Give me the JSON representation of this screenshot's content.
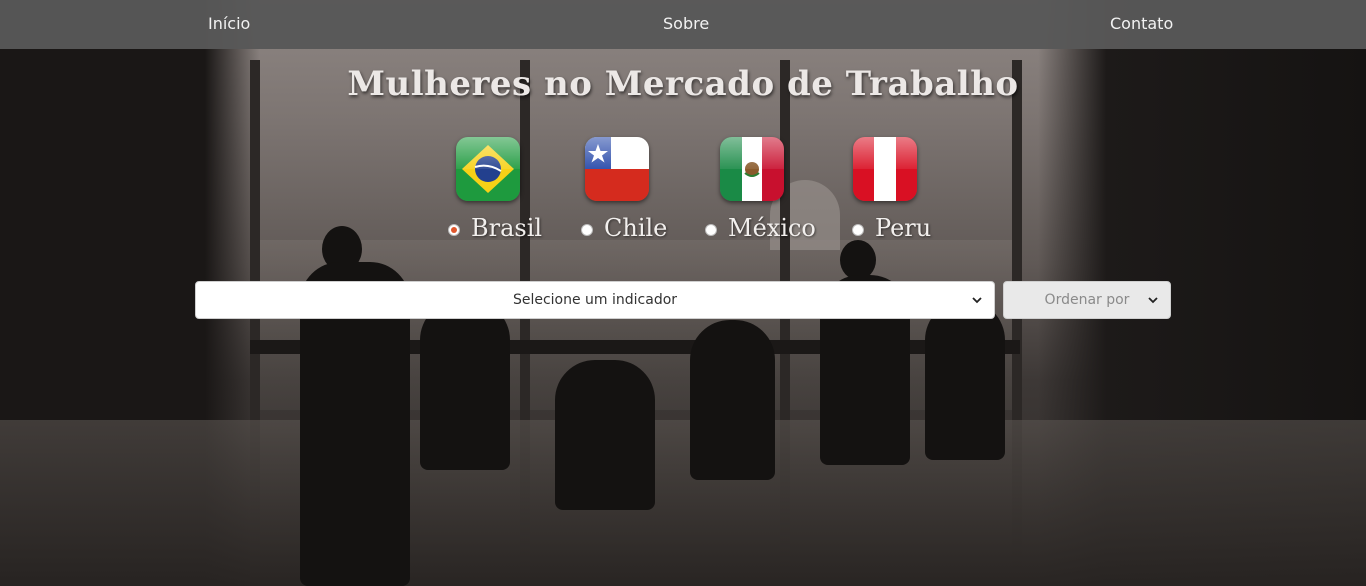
{
  "nav": {
    "home": "Início",
    "about": "Sobre",
    "contact": "Contato"
  },
  "page": {
    "title": "Mulheres no Mercado de Trabalho"
  },
  "countries": [
    {
      "label": "Brasil",
      "selected": true,
      "flag_icon": "brazil-flag-icon"
    },
    {
      "label": "Chile",
      "selected": false,
      "flag_icon": "chile-flag-icon"
    },
    {
      "label": "México",
      "selected": false,
      "flag_icon": "mexico-flag-icon"
    },
    {
      "label": "Peru",
      "selected": false,
      "flag_icon": "peru-flag-icon"
    }
  ],
  "filters": {
    "indicator_placeholder": "Selecione um indicador",
    "order_placeholder": "Ordenar por"
  },
  "colors": {
    "navbar": "#585858",
    "radio_selected": "#e0572d"
  }
}
